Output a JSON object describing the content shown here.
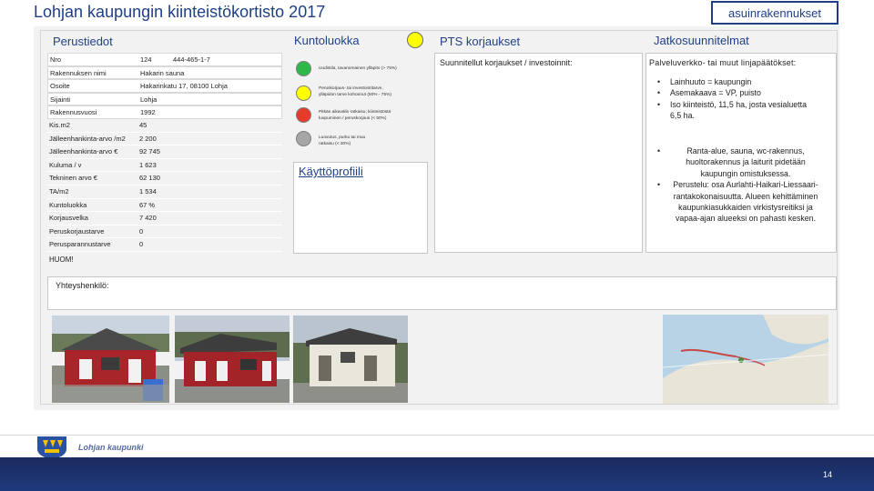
{
  "header": {
    "title": "Lohjan kaupungin kiinteistökortisto 2017",
    "tag": "asuinrakennukset"
  },
  "sections": {
    "perustiedot": "Perustiedot",
    "kuntoluokka": "Kuntoluokka",
    "pts": "PTS korjaukset",
    "jatko": "Jatkosuunnitelmat",
    "kayttoprofiili": "Käyttöprofiili"
  },
  "info_rows": [
    {
      "label": "Nro",
      "value": "124",
      "value2": "444-465-1-7"
    },
    {
      "label": "Rakennuksen nimi",
      "value": "Hakarin sauna",
      "value2": ""
    },
    {
      "label": "Osoite",
      "value": "Hakarinkatu 17, 08100 Lohja",
      "value2": ""
    },
    {
      "label": "Sijainti",
      "value": "Lohja",
      "value2": ""
    },
    {
      "label": "Rakennusvuosi",
      "value": "1992",
      "value2": ""
    },
    {
      "label": "Kis.m2",
      "value": "45",
      "value2": ""
    },
    {
      "label": "Jälleenhankinta-arvo /m2",
      "value": "2 200",
      "value2": ""
    },
    {
      "label": "Jälleenhankinta-arvo €",
      "value": "92 745",
      "value2": ""
    },
    {
      "label": "Kuluma / v",
      "value": "1 623",
      "value2": ""
    },
    {
      "label": "Tekninen arvo €",
      "value": "62 130",
      "value2": ""
    },
    {
      "label": "TA/m2",
      "value": "1 534",
      "value2": ""
    },
    {
      "label": "Kuntoluokka",
      "value": "67 %",
      "value2": ""
    },
    {
      "label": "Korjausvelka",
      "value": "7 420",
      "value2": ""
    },
    {
      "label": "Peruskorjaustarve",
      "value": "0",
      "value2": ""
    },
    {
      "label": "Perusparannustarve",
      "value": "0",
      "value2": ""
    }
  ],
  "condition_classes": [
    {
      "color": "#2eb84a",
      "line1": "Uudistila, tavanomainen ylläpito (> 75%)",
      "line2": ""
    },
    {
      "color": "#ffff00",
      "line1": "Peruskorjaus- tai investointitarve,",
      "line2": "ylläpidon tarve kohonnut (50% - 75%)"
    },
    {
      "color": "#e63a2a",
      "line1": "Pitkän aikavälin ratkaisu; kiinteistöstä",
      "line2": "luopuminen / peruskorjaus (< 50%)"
    },
    {
      "color": "#a6a6a6",
      "line1": "Luovutus, purku tai muu",
      "line2": "ratkaisu (< 30%)"
    }
  ],
  "kuntoluokka_indicator_color": "#ffff00",
  "pts": {
    "text": "Suunnitellut korjaukset / investoinnit:"
  },
  "jatko": {
    "intro": "Palveluverkko- tai muut linjapäätökset:",
    "bullets1": [
      "Lainhuuto = kaupungin",
      "Asemakaava = VP, puisto",
      "Iso kiinteistö, 11,5 ha, josta vesialuetta 6,5 ha."
    ],
    "bullets2": [
      "Ranta-alue, sauna, wc-rakennus, huoltorakennus ja laiturit pidetään kaupungin omistuksessa.",
      "Perustelu: osa Aurlahti-Haikari-Liessaari-rantakokonaisuutta. Alueen kehittäminen kaupunkiasukkaiden virkistysreitiksi ja vapaa-ajan alueeksi on pahasti kesken."
    ]
  },
  "huom": "HUOM!",
  "yhteys": "Yhteyshenkilö:",
  "footer": {
    "brand": "Lohjan kaupunki",
    "page": "14"
  },
  "colors": {
    "brand_blue": "#1f3f87",
    "footer_dark": "#1b2a5e"
  }
}
